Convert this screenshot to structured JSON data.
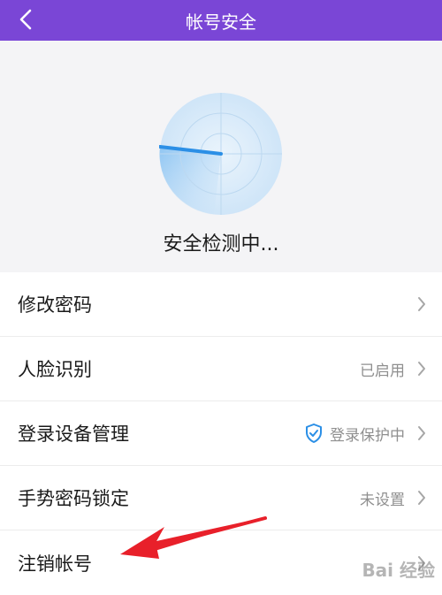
{
  "header": {
    "title": "帐号安全",
    "back_icon": "chevron-left-icon",
    "bg_color": "#7a46d6"
  },
  "scan": {
    "status_text": "安全检测中...",
    "radar_icon": "radar-scan-icon",
    "accent_color": "#2b8fe6"
  },
  "menu": {
    "items": [
      {
        "label": "修改密码",
        "value": "",
        "icon": ""
      },
      {
        "label": "人脸识别",
        "value": "已启用",
        "icon": ""
      },
      {
        "label": "登录设备管理",
        "value": "登录保护中",
        "icon": "shield-check-icon"
      },
      {
        "label": "手势密码锁定",
        "value": "未设置",
        "icon": ""
      },
      {
        "label": "注销帐号",
        "value": "",
        "icon": ""
      }
    ]
  },
  "annotation": {
    "arrow_color": "#e8202a"
  },
  "watermark": {
    "text": "Bai 经验"
  }
}
